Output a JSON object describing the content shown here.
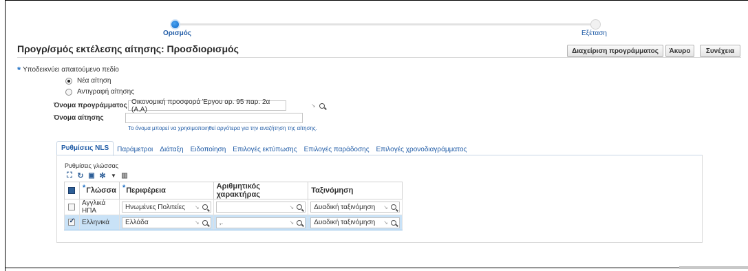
{
  "train": {
    "step1_label": "Ορισμός",
    "step2_label": "Εξέταση"
  },
  "page": {
    "title": "Προγρ/σμός εκτέλεσης αίτησης: Προσδιορισμός",
    "required_note": "Υποδεικνύει απαιτούμενο πεδίο"
  },
  "buttons": {
    "manage_schedule": "Διαχείριση προγράμματος",
    "cancel": "Άκυρο",
    "continue": "Συνέχεια"
  },
  "request_type": {
    "new_request": "Νέα αίτηση",
    "copy_request": "Αντιγραφή αίτησης",
    "selected": "new_request"
  },
  "fields": {
    "program_name_label": "Όνομα προγράμματος",
    "program_name_value": "Οικονομική προσφορά Έργου αρ. 95 παρ. 2α (Α.Α)",
    "request_name_label": "Όνομα αίτησης",
    "request_name_value": "",
    "request_name_hint": "Το όνομα μπορεί να χρησιμοποιηθεί αργότερα για την αναζήτηση της αίτησης."
  },
  "tabs": [
    {
      "label": "Ρυθμίσεις NLS",
      "active": true
    },
    {
      "label": "Παράμετροι",
      "active": false
    },
    {
      "label": "Διάταξη",
      "active": false
    },
    {
      "label": "Ειδοποίηση",
      "active": false
    },
    {
      "label": "Επιλογές εκτύπωσης",
      "active": false
    },
    {
      "label": "Επιλογές παράδοσης",
      "active": false
    },
    {
      "label": "Επιλογές χρονοδιαγράμματος",
      "active": false
    }
  ],
  "nls": {
    "section_label": "Ρυθμίσεις γλώσσας",
    "columns": {
      "language": "Γλώσσα",
      "territory": "Περιφέρεια",
      "numeric_char": "Αριθμητικός χαρακτήρας",
      "sort": "Ταξινόμηση"
    },
    "rows": [
      {
        "checked": false,
        "language": "Αγγλικά ΗΠΑ",
        "territory": "Ηνωμένες Πολιτείες",
        "numeric_char": "",
        "sort": "Δυαδική ταξινόμηση"
      },
      {
        "checked": true,
        "language": "Ελληνικά",
        "territory": "Ελλάδα",
        "numeric_char": ",.",
        "sort": "Δυαδική ταξινόμηση"
      }
    ]
  },
  "icons": {
    "lov_search": "magnifier-icon",
    "lov_expand": "arrow-se-icon",
    "toolbar": [
      "detach-icon",
      "refresh-icon",
      "freeze-icon",
      "settings-icon",
      "dropdown-arrow-icon",
      "columns-icon"
    ]
  },
  "colors": {
    "link": "#1f5ba6",
    "required_star": "#1e6fc4",
    "selected_row": "#c9e2f7",
    "train_active": "#0a66c8"
  }
}
